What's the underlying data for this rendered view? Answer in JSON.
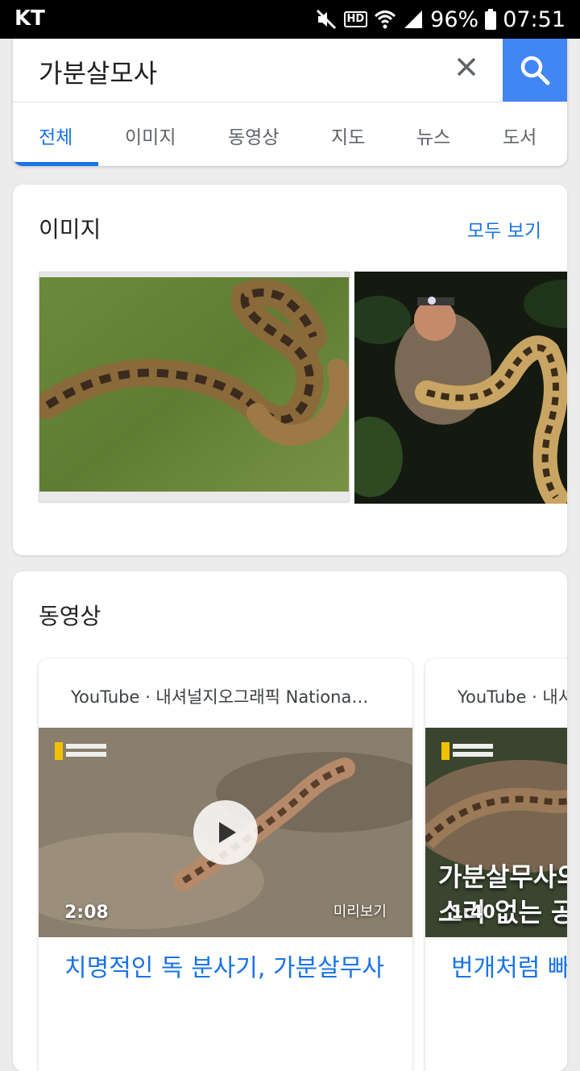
{
  "status_bar": {
    "carrier": "KT",
    "battery": "96%",
    "time": "07:51",
    "hd": "HD"
  },
  "search": {
    "query": "가분살모사",
    "clear_icon": "close-icon",
    "search_icon": "search-icon"
  },
  "tabs": [
    {
      "label": "전체",
      "active": true
    },
    {
      "label": "이미지"
    },
    {
      "label": "동영상"
    },
    {
      "label": "지도"
    },
    {
      "label": "뉴스"
    },
    {
      "label": "도서"
    }
  ],
  "images_section": {
    "title": "이미지",
    "see_all": "모두 보기"
  },
  "videos_section": {
    "title": "동영상",
    "videos": [
      {
        "source": "YouTube · 내셔널지오그래픽 Nationa…",
        "duration": "2:08",
        "preview": "미리보기",
        "title": "치명적인 독 분사기, 가분살무사"
      },
      {
        "source": "YouTube · 내셔",
        "duration": "1:40",
        "overlay_line1": "가분살무사의",
        "overlay_line2": "소리 없는 공",
        "title": "번개처럼 빠른"
      }
    ]
  },
  "colors": {
    "accent": "#1a73e8",
    "search_button": "#4285f4"
  }
}
